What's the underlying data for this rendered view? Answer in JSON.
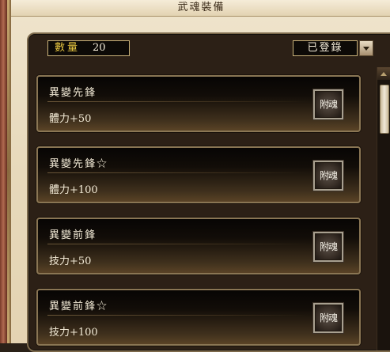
{
  "window": {
    "title": "武魂裝備"
  },
  "header": {
    "count_label": "數量",
    "count_value": "20",
    "filter_selected": "已登錄"
  },
  "items": [
    {
      "name": "異變先鋒",
      "stat": "體力+50",
      "button": "附魂"
    },
    {
      "name": "異變先鋒☆",
      "stat": "體力+100",
      "button": "附魂"
    },
    {
      "name": "異變前鋒",
      "stat": "技力+50",
      "button": "附魂"
    },
    {
      "name": "異變前鋒☆",
      "stat": "技力+100",
      "button": "附魂"
    }
  ]
}
